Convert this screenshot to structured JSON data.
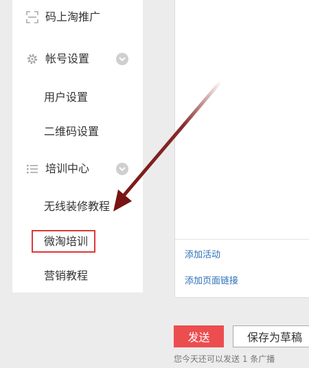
{
  "sidebar": {
    "items": [
      {
        "label": "码上淘推广",
        "icon": "scan-icon"
      },
      {
        "label": "帐号设置",
        "icon": "gear-icon",
        "expandable": true
      },
      {
        "label": "用户设置",
        "type": "sub"
      },
      {
        "label": "二维码设置",
        "type": "sub"
      },
      {
        "label": "培训中心",
        "icon": "list-icon",
        "expandable": true
      },
      {
        "label": "无线装修教程",
        "type": "sub"
      },
      {
        "label": "微淘培训",
        "type": "sub",
        "highlighted": true
      },
      {
        "label": "营销教程",
        "type": "sub"
      }
    ]
  },
  "panel": {
    "links": [
      "添加活动",
      "添加页面链接"
    ]
  },
  "actions": {
    "send_label": "发送",
    "draft_label": "保存为草稿",
    "quota_text": "您今天还可以发送 1 条广播"
  },
  "colors": {
    "accent_red": "#ec4d4f",
    "highlight_border": "#d9383a",
    "link_blue": "#2a6fb8",
    "arrow": "#7a1414"
  }
}
